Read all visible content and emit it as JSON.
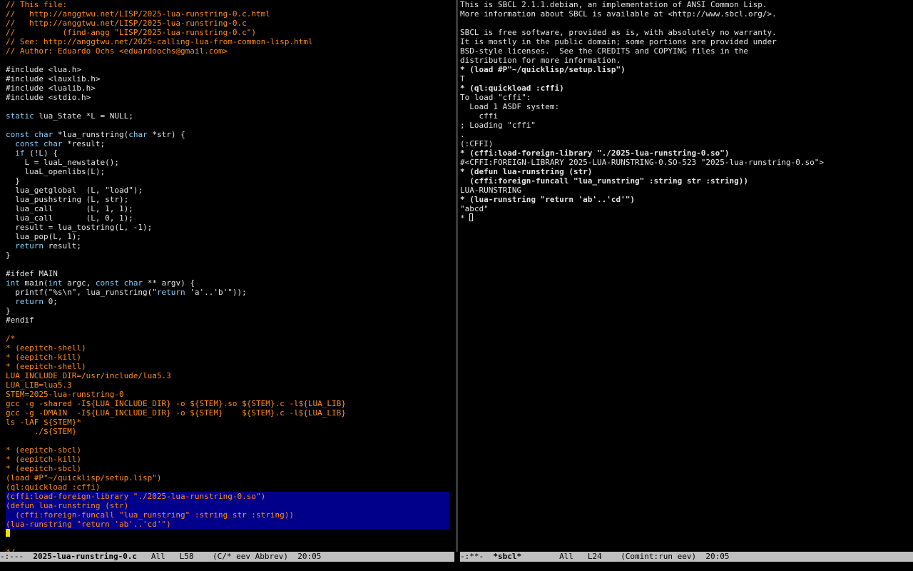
{
  "left_buffer": {
    "lines": [
      {
        "t": "// This file:",
        "s": "comment"
      },
      {
        "t": "//   http://anggtwu.net/LISP/2025-lua-runstring-0.c.html",
        "s": "comment"
      },
      {
        "t": "//   http://anggtwu.net/LISP/2025-lua-runstring-0.c",
        "s": "comment"
      },
      {
        "t": "//          (find-angg \"LISP/2025-lua-runstring-0.c\")",
        "s": "comment"
      },
      {
        "t": "// See: http://anggtwu.net/2025-calling-lua-from-common-lisp.html",
        "s": "comment"
      },
      {
        "t": "// Author: Eduardo Ochs <eduardoochs@gmail.com>",
        "s": "comment"
      },
      {
        "t": "",
        "s": ""
      },
      {
        "t": "#include <lua.h>",
        "s": "preproc"
      },
      {
        "t": "#include <lauxlib.h>",
        "s": "preproc"
      },
      {
        "t": "#include <lualib.h>",
        "s": "preproc"
      },
      {
        "t": "#include <stdio.h>",
        "s": "preproc"
      },
      {
        "t": "",
        "s": ""
      },
      {
        "t": "static lua_State *L = NULL;",
        "s": "code"
      },
      {
        "t": "",
        "s": ""
      },
      {
        "t": "const char *lua_runstring(char *str) {",
        "s": "code"
      },
      {
        "t": "  const char *result;",
        "s": "code"
      },
      {
        "t": "  if (!L) {",
        "s": "code"
      },
      {
        "t": "    L = luaL_newstate();",
        "s": "code"
      },
      {
        "t": "    luaL_openlibs(L);",
        "s": "code"
      },
      {
        "t": "  }",
        "s": "code"
      },
      {
        "t": "  lua_getglobal  (L, \"load\");",
        "s": "code"
      },
      {
        "t": "  lua_pushstring (L, str);",
        "s": "code"
      },
      {
        "t": "  lua_call       (L, 1, 1);",
        "s": "code"
      },
      {
        "t": "  lua_call       (L, 0, 1);",
        "s": "code"
      },
      {
        "t": "  result = lua_tostring(L, -1);",
        "s": "code"
      },
      {
        "t": "  lua_pop(L, 1);",
        "s": "code"
      },
      {
        "t": "  return result;",
        "s": "code"
      },
      {
        "t": "}",
        "s": "code"
      },
      {
        "t": "",
        "s": ""
      },
      {
        "t": "#ifdef MAIN",
        "s": "preproc"
      },
      {
        "t": "int main(int argc, const char ** argv) {",
        "s": "code"
      },
      {
        "t": "  printf(\"%s\\n\", lua_runstring(\"return 'a'..'b'\"));",
        "s": "code"
      },
      {
        "t": "  return 0;",
        "s": "code"
      },
      {
        "t": "}",
        "s": "code"
      },
      {
        "t": "#endif",
        "s": "preproc"
      },
      {
        "t": "",
        "s": ""
      },
      {
        "t": "/*",
        "s": "comment"
      },
      {
        "t": "* (eepitch-shell)",
        "s": "comment"
      },
      {
        "t": "* (eepitch-kill)",
        "s": "comment"
      },
      {
        "t": "* (eepitch-shell)",
        "s": "comment"
      },
      {
        "t": "LUA_INCLUDE_DIR=/usr/include/lua5.3",
        "s": "comment"
      },
      {
        "t": "LUA_LIB=lua5.3",
        "s": "comment"
      },
      {
        "t": "STEM=2025-lua-runstring-0",
        "s": "comment"
      },
      {
        "t": "gcc -g -shared -I${LUA_INCLUDE_DIR} -o ${STEM}.so ${STEM}.c -l${LUA_LIB}",
        "s": "comment"
      },
      {
        "t": "gcc -g -DMAIN  -I${LUA_INCLUDE_DIR} -o ${STEM}    ${STEM}.c -l${LUA_LIB}",
        "s": "comment"
      },
      {
        "t": "ls -lAF ${STEM}*",
        "s": "comment"
      },
      {
        "t": "      ./${STEM}",
        "s": "comment"
      },
      {
        "t": "",
        "s": ""
      },
      {
        "t": "* (eepitch-sbcl)",
        "s": "comment"
      },
      {
        "t": "* (eepitch-kill)",
        "s": "comment"
      },
      {
        "t": "* (eepitch-sbcl)",
        "s": "comment"
      },
      {
        "t": "(load #P\"~/quicklisp/setup.lisp\")",
        "s": "comment"
      },
      {
        "t": "(ql:quickload :cffi)",
        "s": "comment"
      },
      {
        "t": "(cffi:load-foreign-library \"./2025-lua-runstring-0.so\")",
        "s": "comment",
        "hl": true
      },
      {
        "t": "(defun lua-runstring (str)",
        "s": "comment",
        "hl": true
      },
      {
        "t": "  (cffi:foreign-funcall \"lua_runstring\" :string str :string))",
        "s": "comment",
        "hl": true
      },
      {
        "t": "(lua-runstring \"return 'ab'..'cd'\")",
        "s": "comment",
        "hl": true
      },
      {
        "t": "",
        "s": "",
        "cursor": true
      },
      {
        "t": "",
        "s": ""
      },
      {
        "t": "*/",
        "s": "comment"
      }
    ],
    "keywords": [
      "const",
      "char",
      "static",
      "int",
      "return",
      "if"
    ]
  },
  "right_buffer": {
    "lines": [
      {
        "t": "This is SBCL 2.1.1.debian, an implementation of ANSI Common Lisp.",
        "s": "out"
      },
      {
        "t": "More information about SBCL is available at <http://www.sbcl.org/>.",
        "s": "out"
      },
      {
        "t": "",
        "s": ""
      },
      {
        "t": "SBCL is free software, provided as is, with absolutely no warranty.",
        "s": "out"
      },
      {
        "t": "It is mostly in the public domain; some portions are provided under",
        "s": "out"
      },
      {
        "t": "BSD-style licenses.  See the CREDITS and COPYING files in the",
        "s": "out"
      },
      {
        "t": "distribution for more information.",
        "s": "out"
      },
      {
        "t": "* (load #P\"~/quicklisp/setup.lisp\")",
        "s": "input"
      },
      {
        "t": "T",
        "s": "out"
      },
      {
        "t": "* (ql:quickload :cffi)",
        "s": "input"
      },
      {
        "t": "To load \"cffi\":",
        "s": "out"
      },
      {
        "t": "  Load 1 ASDF system:",
        "s": "out"
      },
      {
        "t": "    cffi",
        "s": "out"
      },
      {
        "t": "; Loading \"cffi\"",
        "s": "out"
      },
      {
        "t": ".",
        "s": "out"
      },
      {
        "t": "(:CFFI)",
        "s": "out"
      },
      {
        "t": "* (cffi:load-foreign-library \"./2025-lua-runstring-0.so\")",
        "s": "input"
      },
      {
        "t": "#<CFFI:FOREIGN-LIBRARY 2025-LUA-RUNSTRING-0.SO-523 \"2025-lua-runstring-0.so\">",
        "s": "out"
      },
      {
        "t": "* (defun lua-runstring (str)",
        "s": "input"
      },
      {
        "t": "  (cffi:foreign-funcall \"lua_runstring\" :string str :string))",
        "s": "input"
      },
      {
        "t": "LUA-RUNSTRING",
        "s": "out"
      },
      {
        "t": "* (lua-runstring \"return 'ab'..'cd'\")",
        "s": "input"
      },
      {
        "t": "\"abcd\"",
        "s": "out"
      },
      {
        "t": "* ",
        "s": "out",
        "cursor": true
      }
    ]
  },
  "modeline_left": {
    "status": "-:---  ",
    "buffer": "2025-lua-runstring-0.c",
    "position": "   All   L58    ",
    "modes": "(C/* eev Abbrev)",
    "time": "  20:05"
  },
  "modeline_right": {
    "status": "-:**-  ",
    "buffer": "*sbcl*",
    "position": "        All   L24    ",
    "modes": "(Comint:run eev)",
    "time": "  20:05"
  },
  "colors": {
    "comment": "#ff8c1a",
    "keyword": "#87cefa",
    "region": "#00008b",
    "cursor": "#f0e000",
    "modeline": "#bfbfbf"
  }
}
